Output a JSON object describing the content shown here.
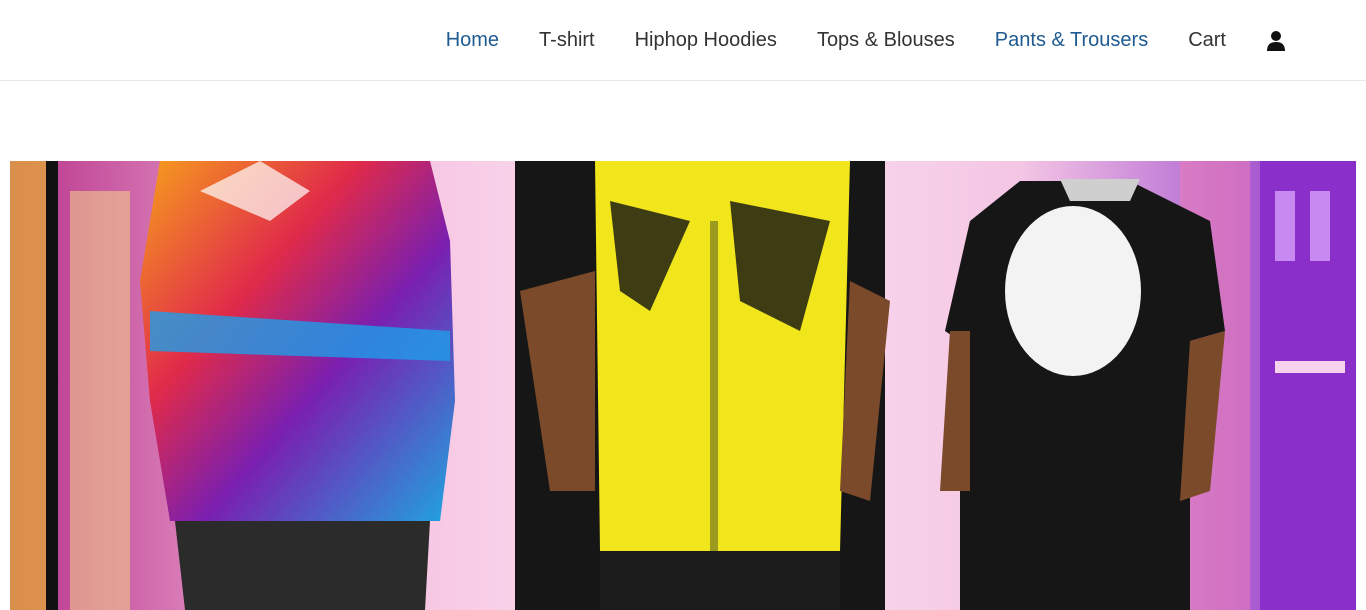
{
  "header": {
    "nav": [
      {
        "label": "Home",
        "active": true
      },
      {
        "label": "T-shirt",
        "active": false
      },
      {
        "label": "Hiphop Hoodies",
        "active": false
      },
      {
        "label": "Tops & Blouses",
        "active": false
      },
      {
        "label": "Pants & Trousers",
        "active": true
      },
      {
        "label": "Cart",
        "active": false
      }
    ],
    "account_icon": "user-icon"
  },
  "hero": {
    "image": "hiphop-streetwear-illustration",
    "colors": {
      "background_pink": "#f4c6e4",
      "building_purple": "#8a2fc9",
      "vest_yellow": "#f1e61c",
      "shirt_black": "#161616",
      "skin": "#7a4a2a"
    }
  },
  "colors": {
    "nav_text": "#333333",
    "nav_active": "#1f5a91",
    "divider": "#e6e6e6"
  }
}
